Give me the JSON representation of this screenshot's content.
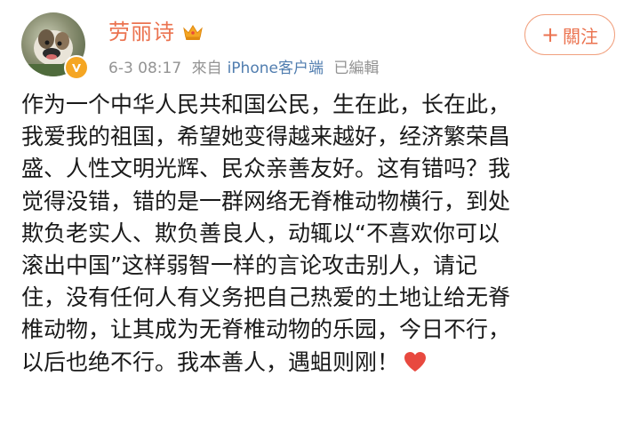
{
  "user": {
    "name": "劳丽诗",
    "avatar": "avatar-photo-dog",
    "verified_badge": "verified-badge-icon",
    "crown_icon": "crown-icon"
  },
  "post_meta": {
    "date": "6-3 08:17",
    "source_prefix": "來自",
    "source": "iPhone客户端",
    "edited": "已編輯"
  },
  "follow_button": {
    "plus": "+",
    "label": "關注"
  },
  "post": {
    "lines": [
      "作为一个中华人民共和国公民，生在此，长在此，",
      "我爱我的祖国，希望她变得越来越好，经济繁荣昌",
      "盛、人性文明光辉、民众亲善友好。这有错吗？我",
      "觉得没错，错的是一群网络无脊椎动物横行，到处",
      "欺负老实人、欺负善良人，动辄以“不喜欢你可以",
      "滚出中国”这样弱智一样的言论攻击别人，请记",
      "住，没有任何人有义务把自己热爱的土地让给无脊",
      "椎动物，让其成为无脊椎动物的乐园，今日不行，",
      "以后也绝不行。我本善人，遇蛆则刚！"
    ],
    "end_icon": "heart-icon"
  },
  "colors": {
    "name": "#eb7350",
    "meta": "#939393",
    "source_link": "#507daf",
    "body_text": "#1a1a1a",
    "heart": "#e8493f",
    "badge": "#f5a623"
  }
}
